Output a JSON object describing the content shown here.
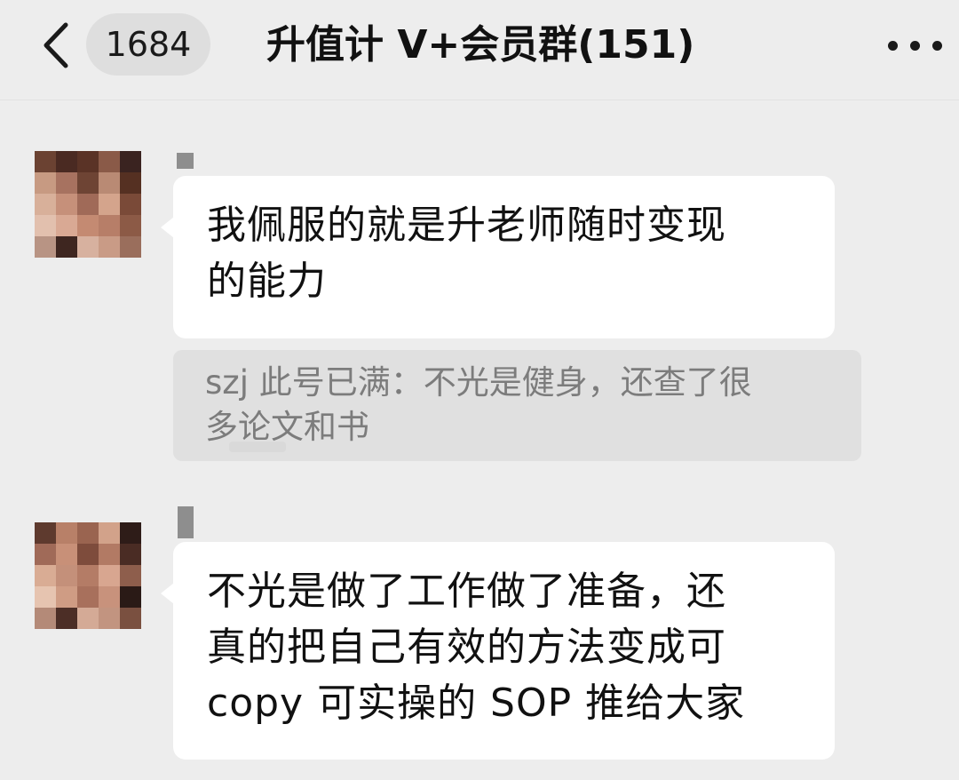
{
  "header": {
    "unread_count": "1684",
    "title": "升值计 V+会员群(151)"
  },
  "icons": {
    "back": "chevron-left-icon",
    "more": "more-horizontal-icon"
  },
  "colors": {
    "background": "#ededed",
    "bubble_incoming": "#ffffff",
    "quote_background": "#e0e0e0",
    "quote_text": "#7c7c7c"
  },
  "messages": [
    {
      "sender": "",
      "lines": [
        "我佩服的就是升老师随时变现",
        "的能力"
      ],
      "quote": {
        "lines": [
          "szj 此号已满：不光是健身，还查了很",
          "多论文和书"
        ]
      }
    },
    {
      "sender": "",
      "lines": [
        "不光是做了工作做了准备，还",
        "真的把自己有效的方法变成可",
        "copy 可实操的 SOP 推给大家"
      ]
    }
  ]
}
